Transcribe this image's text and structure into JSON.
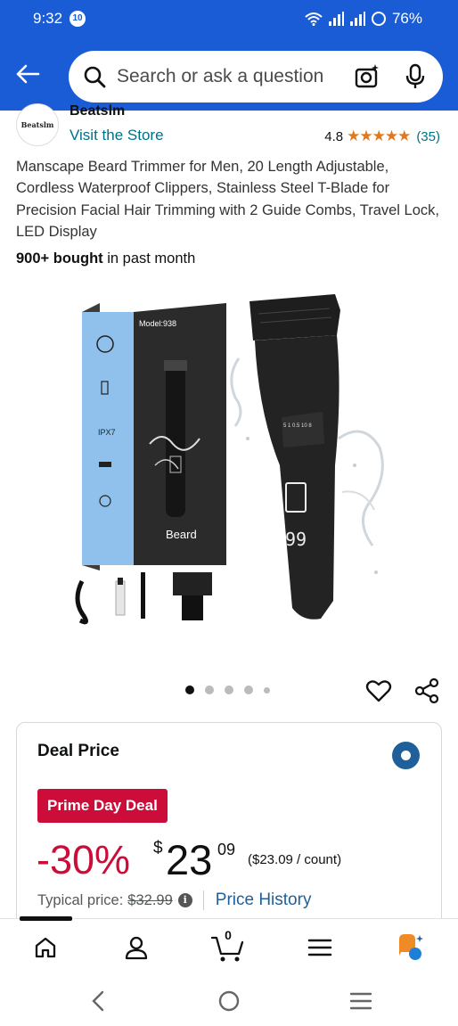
{
  "status_bar": {
    "time": "9:32",
    "notification_badge": "10",
    "battery": "76%"
  },
  "header": {
    "search_placeholder": "Search or ask a question"
  },
  "store": {
    "logo_text": "Beatslm",
    "brand_name": "Beatslm",
    "visit_label": "Visit the Store",
    "rating_value": "4.8",
    "stars": "★★★★★",
    "rating_count": "(35)"
  },
  "product": {
    "title": "Manscape Beard Trimmer for Men, 20 Length Adjustable, Cordless Waterproof Clippers, Stainless Steel T-Blade for Precision Facial Hair Trimming with 2 Guide Combs, Travel Lock, LED Display",
    "bought_bold": "900+ bought",
    "bought_rest": " in past month",
    "image": {
      "box_model": "Model:938",
      "box_brand": "Beard",
      "box_label_ipx": "IPX7",
      "display_digits": "99",
      "scale_marks": "5 1 0.5 10 8"
    }
  },
  "carousel": {
    "total_dots": 5,
    "active_index": 0
  },
  "deal": {
    "title": "Deal Price",
    "badge": "Prime Day Deal",
    "discount": "-30%",
    "currency": "$",
    "price_whole": "23",
    "price_fraction": "09",
    "unit_price": "($23.09 / count)",
    "typical_label": "Typical price:",
    "typical_price": "$32.99",
    "info_icon": "i",
    "price_history": "Price History"
  },
  "bottom_nav": {
    "items": [
      "home-icon",
      "account-icon",
      "cart-icon",
      "menu-icon",
      "rufus-icon"
    ],
    "cart_count": "0"
  },
  "colors": {
    "header_blue": "#1a5bd6",
    "link": "#007185",
    "deal_red": "#cc0c39",
    "radio_blue": "#1f5f9a",
    "star": "#de7921"
  }
}
